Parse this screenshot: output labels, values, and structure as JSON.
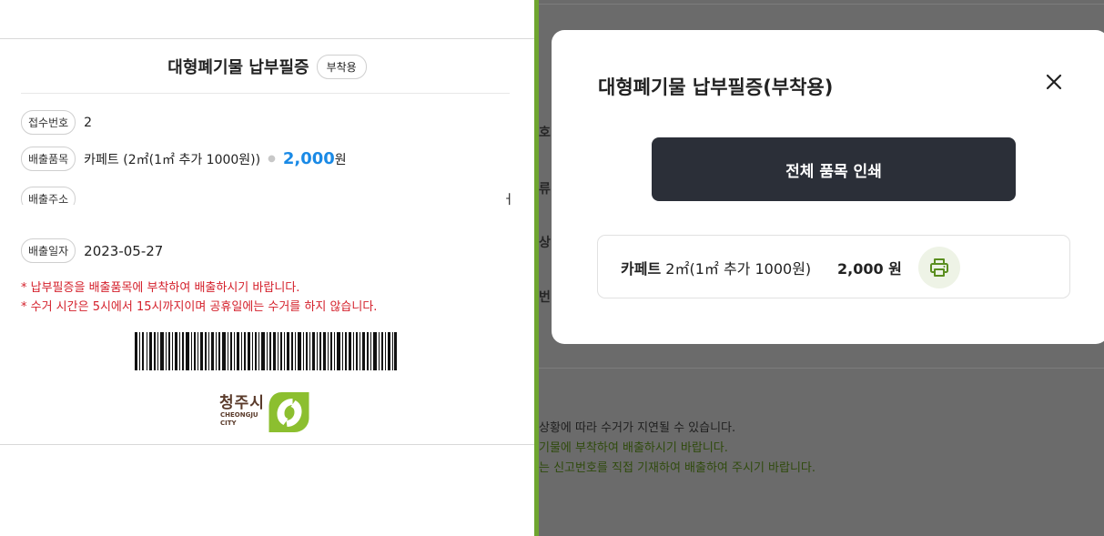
{
  "receipt": {
    "title": "대형폐기물 납부필증",
    "badge": "부착용",
    "fields": {
      "receipt_no_label": "접수번호",
      "receipt_no_value": "2",
      "item_label": "배출품목",
      "item_value": "카페트 (2㎡(1㎡ 추가 1000원))",
      "item_price_number": "2,000",
      "item_price_unit": "원",
      "address_label": "배출주소",
      "address_tail": "ㅓ",
      "date_label": "배출일자",
      "date_value": "2023-05-27"
    },
    "notices": [
      "* 납부필증을 배출품목에 부착하여 배출하시기 바랍니다.",
      "* 수거 시간은 5시에서 15시까지이며 공휴일에는 수거를 하지 않습니다."
    ],
    "logo": {
      "korean": "청주시",
      "english_line1": "CHEONGJU",
      "english_line2": "CITY"
    }
  },
  "background_page": {
    "fragments": [
      "호",
      "류",
      "상",
      "번"
    ],
    "notes": [
      "상황에 따라 수거가 지연될 수 있습니다.",
      "기물에 부착하여 배출하시기 바랍니다.",
      "는 신고번호를 직접 기재하여 배출하여 주시기 바랍니다."
    ]
  },
  "modal": {
    "title": "대형폐기물 납부필증(부착용)",
    "print_all_label": "전체 품목 인쇄",
    "items": [
      {
        "name": "카페트",
        "spec": "2㎡(1㎡ 추가 1000원)",
        "price": "2,000 원"
      }
    ]
  },
  "colors": {
    "accent_green": "#6fa52f",
    "price_blue": "#1a8ae6",
    "notice_red": "#d4202b",
    "dark_button": "#2b2f38",
    "overlay": "#6b6b6b"
  },
  "icons": [
    "close-icon",
    "printer-icon",
    "barcode",
    "cheongju-city-logo"
  ]
}
